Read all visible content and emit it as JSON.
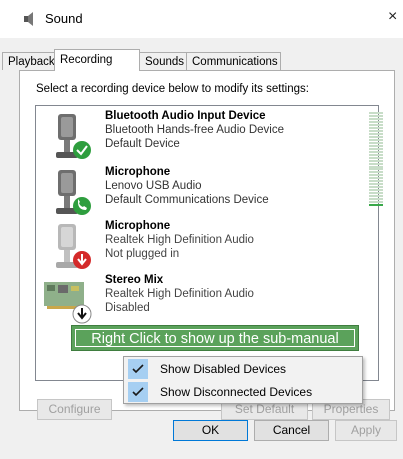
{
  "window": {
    "title": "Sound",
    "close_glyph": "×",
    "icon": "speaker-icon"
  },
  "tabs": [
    {
      "label": "Playback",
      "active": false
    },
    {
      "label": "Recording",
      "active": true
    },
    {
      "label": "Sounds",
      "active": false
    },
    {
      "label": "Communications",
      "active": false
    }
  ],
  "instruction": "Select a recording device below to modify its settings:",
  "devices": [
    {
      "name": "Bluetooth Audio Input Device",
      "line1": "Bluetooth Hands-free Audio Device",
      "line2": "Default Device",
      "icon": "microphone-icon",
      "badge": "green-check-badge"
    },
    {
      "name": "Microphone",
      "line1": "Lenovo USB Audio",
      "line2": "Default Communications Device",
      "icon": "microphone-icon",
      "badge": "green-phone-badge"
    },
    {
      "name": "Microphone",
      "line1": "Realtek High Definition Audio",
      "line2": "Not plugged in",
      "icon": "microphone-icon",
      "badge": "red-down-arrow-badge"
    },
    {
      "name": "Stereo Mix",
      "line1": "Realtek High Definition Audio",
      "line2": "Disabled",
      "icon": "sound-card-icon",
      "badge": "black-down-arrow-badge"
    }
  ],
  "callout": {
    "text": "Right Click to show up the sub-manual"
  },
  "context_menu": {
    "items": [
      {
        "label": "Show Disabled Devices",
        "checked": true
      },
      {
        "label": "Show Disconnected Devices",
        "checked": true
      }
    ]
  },
  "panel_buttons": {
    "configure": "Configure",
    "set_default": "Set Default",
    "properties": "Properties"
  },
  "dialog_buttons": {
    "ok": "OK",
    "cancel": "Cancel",
    "apply": "Apply"
  },
  "colors": {
    "callout_bg": "#5ba25b",
    "menu_check_bg": "#a6cff2",
    "default_button_border": "#0078d7"
  }
}
